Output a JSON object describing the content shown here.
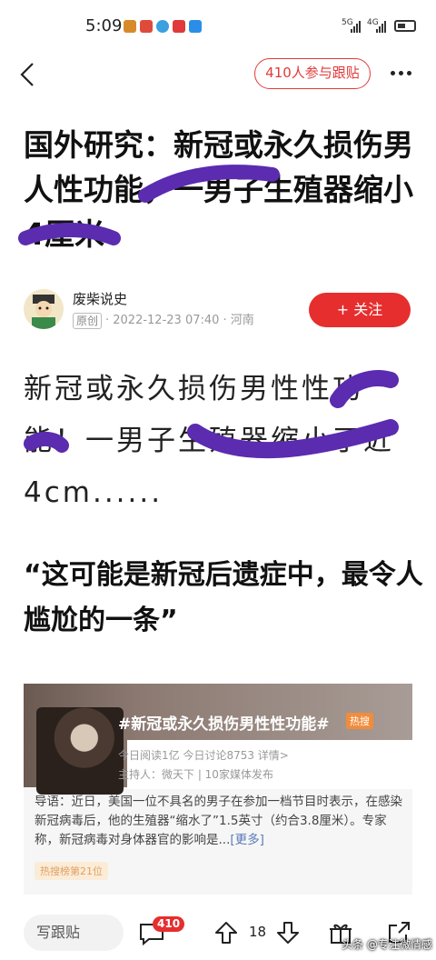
{
  "status_bar": {
    "time": "5:09",
    "network_1": "5G",
    "network_2": "4G"
  },
  "nav": {
    "participants_label": "410人参与跟贴",
    "back_icon": "chevron-left-icon",
    "more_icon": "more-dots-icon"
  },
  "article": {
    "headline": "国外研究：新冠或永久损伤男人性功能，一男子生殖器缩小4厘米",
    "author": "废柴说史",
    "badge": "原创",
    "meta": "· 2022-12-23 07:40 · 河南",
    "follow_label": "+ 关注",
    "paragraph": "新冠或永久损伤男性性功能！一男子生殖器缩小了近4cm......",
    "quote": "“这可能是新冠后遗症中，最令人尴尬的一条”"
  },
  "topic_card": {
    "title": "#新冠或永久损伤男性性功能#",
    "hot_badge": "热搜",
    "stats": "今日阅读1亿  今日讨论8753  详情>",
    "host": "主持人：微天下 | 10家媒体发布",
    "intro": "导语：近日，美国一位不具名的男子在参加一档节目时表示，在感染新冠病毒后，他的生殖器“缩水了”1.5英寸（约合3.8厘米）。专家称，新冠病毒对身体器官的影响是...",
    "more_link": "[更多]",
    "rank": "热搜榜第21位"
  },
  "bottom_bar": {
    "reply_placeholder": "写跟贴",
    "comment_count": "410",
    "vote_count": "18"
  },
  "watermark": "头条 @专注微情感",
  "colors": {
    "accent_red": "#e62e2e",
    "scribble_purple": "#5b2bb0"
  }
}
